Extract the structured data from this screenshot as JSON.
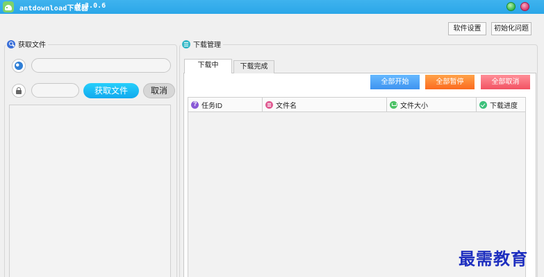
{
  "window": {
    "app_name": "antdownload下载器",
    "version": "V:3.0.6"
  },
  "toolbar": {
    "settings_label": "软件设置",
    "init_label": "初始化问题"
  },
  "fetch_panel": {
    "title": "获取文件",
    "url_value": "",
    "code_value": "",
    "fetch_label": "获取文件",
    "cancel_label": "取消"
  },
  "download_panel": {
    "title": "下载管理",
    "tabs": [
      {
        "label": "下载中",
        "active": true
      },
      {
        "label": "下载完成",
        "active": false
      }
    ],
    "actions": {
      "start_all": "全部开始",
      "pause_all": "全部暂停",
      "cancel_all": "全部取消"
    },
    "columns": [
      "任务ID",
      "文件名",
      "文件大小",
      "下载进度"
    ],
    "rows": []
  },
  "watermark": "最需教育",
  "colors": {
    "titlebar": "#2aa6e8",
    "fetch_button": "#11a9ee",
    "start_all": "#3e93f0",
    "pause_all": "#fb6a1f",
    "cancel_all": "#f25262",
    "watermark": "#1e2fbf"
  }
}
